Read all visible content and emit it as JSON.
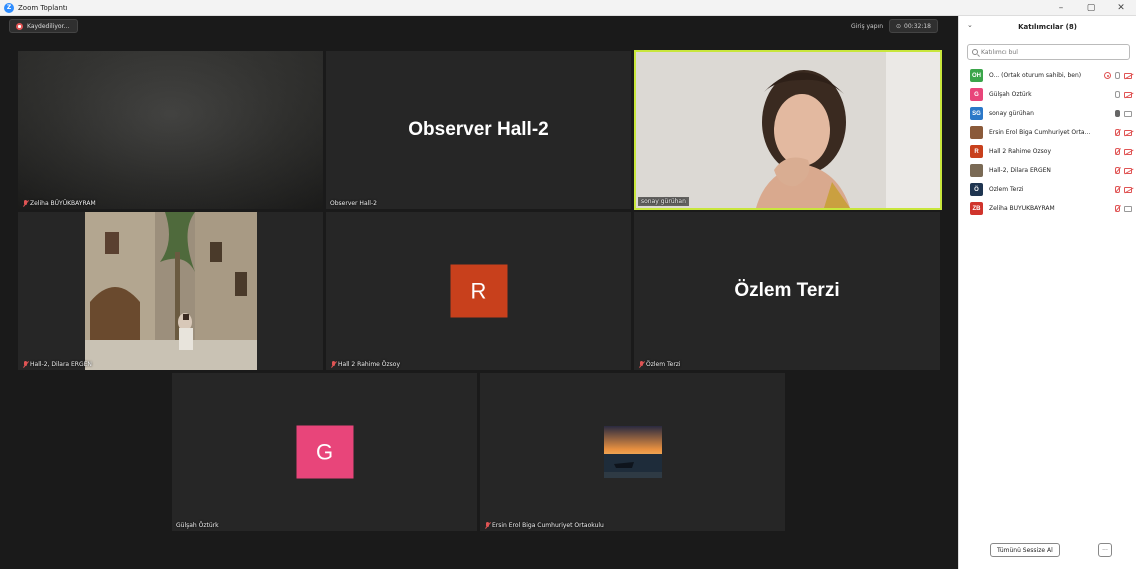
{
  "window": {
    "title": "Zoom Toplantı",
    "minimize": "–",
    "maximize": "▢",
    "close": "✕"
  },
  "meeting": {
    "recording_label": "Kaydediliyor...",
    "join_label": "Giriş yapın",
    "timer": "00:32:18"
  },
  "tiles": [
    {
      "name": "Zeliha BÜYÜKBAYRAM",
      "muted": true,
      "kind": "video-dark"
    },
    {
      "name": "Observer Hall-2",
      "muted": false,
      "kind": "name-only",
      "big_name": "Observer Hall-2"
    },
    {
      "name": "sonay gürühan",
      "muted": false,
      "kind": "video-person",
      "active": true
    },
    {
      "name": "Hall-2, Dilara ERGEN",
      "muted": true,
      "kind": "photo-street"
    },
    {
      "name": "Hall 2 Rahime Özsoy",
      "muted": true,
      "kind": "avatar",
      "avatar_letter": "R"
    },
    {
      "name": "Özlem Terzi",
      "muted": true,
      "kind": "name-only",
      "big_name": "Özlem Terzi"
    },
    {
      "name": "Gülşah Öztürk",
      "muted": false,
      "kind": "avatar",
      "avatar_letter": "G"
    },
    {
      "name": "Ersin Erol Biga Cumhuriyet Ortaokulu",
      "muted": true,
      "kind": "photo-sunset"
    }
  ],
  "colors": {
    "active_border": "#c8e63c",
    "avatar_R": "#c8401c",
    "avatar_G": "#e8457a",
    "mute_red": "#e05454",
    "zoom_blue": "#2d8cff"
  },
  "panel": {
    "title": "Katılımcılar (8)",
    "collapse_icon": "chevron-down-icon",
    "search_placeholder": "Katılımcı bul",
    "participants": [
      {
        "initials": "OH",
        "color": "#3aa54a",
        "name": "O... (Ortak oturum sahibi, ben)",
        "mic": "on-outline",
        "cam": "off",
        "rec": true
      },
      {
        "initials": "G",
        "color": "#e8457a",
        "name": "Gülşah Öztürk",
        "mic": "on-outline",
        "cam": "off",
        "rec": false
      },
      {
        "initials": "SG",
        "color": "#2b78c8",
        "name": "sonay gürühan",
        "mic": "on",
        "cam": "on",
        "rec": false
      },
      {
        "initials": "",
        "color": "#8a5a3a",
        "name": "Ersin Erol Biga Cumhuriyet Orta...",
        "mic": "off",
        "cam": "off",
        "rec": false
      },
      {
        "initials": "R",
        "color": "#c8401c",
        "name": "Hall 2 Rahime Özsoy",
        "mic": "off",
        "cam": "off",
        "rec": false
      },
      {
        "initials": "",
        "color": "#7a6a55",
        "name": "Hall-2, Dilara ERGEN",
        "mic": "off",
        "cam": "off",
        "rec": false
      },
      {
        "initials": "Ö",
        "color": "#1f3550",
        "name": "Özlem Terzi",
        "mic": "off",
        "cam": "off",
        "rec": false
      },
      {
        "initials": "ZB",
        "color": "#d0342c",
        "name": "Zeliha BÜYÜKBAYRAM",
        "mic": "off",
        "cam": "on",
        "rec": false
      }
    ],
    "mute_all_label": "Tümünü Sessize Al",
    "more_label": "···"
  }
}
